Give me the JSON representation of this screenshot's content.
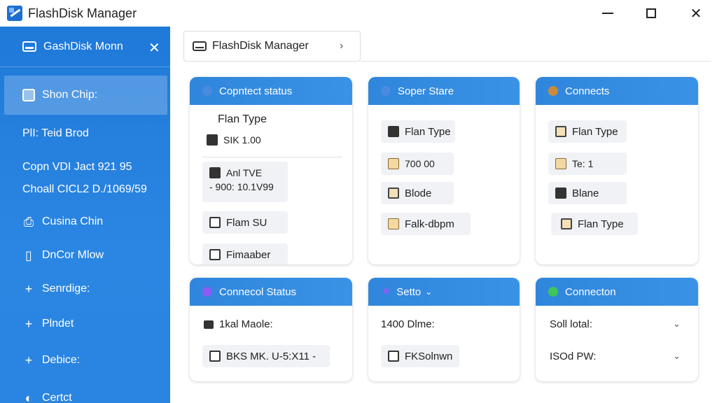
{
  "window": {
    "title": "FlashDisk Manager"
  },
  "sidebar": {
    "title": "GashDisk Monn",
    "items": [
      {
        "label": "Shon Chip:"
      },
      {
        "label": "PlI: Teid Brod"
      },
      {
        "label": "Copn VDI Jact 921 95"
      },
      {
        "label": "Choall CICL2 D./1069/59"
      },
      {
        "label": "Cusina Chin"
      },
      {
        "label": "DnCor Mlow"
      },
      {
        "label": "Senrdige:"
      },
      {
        "label": "Plndet"
      },
      {
        "label": "Debice:"
      },
      {
        "label": "Certct"
      }
    ]
  },
  "breadcrumb": {
    "label": "FlashDisk Manager"
  },
  "cards": {
    "c1": {
      "title": "Copntect status",
      "dot_color": "#4a8be0",
      "heading": "Flan Type",
      "line1": "SIK 1.00",
      "line2a": "Anl TVE",
      "line2b": "-  900: 10.1V99",
      "btn1": "Flam SU",
      "btn2": "Fimaaber"
    },
    "c2": {
      "title": "Soper Stare",
      "dot_color": "#4a8be0",
      "row1": "Flan Type",
      "row2": "700 00",
      "row3": "Blode",
      "row4": "Falk-dbpm"
    },
    "c3": {
      "title": "Connects",
      "dot_color": "#c98a3c",
      "row1": "Flan Type",
      "row2": "Te: 1",
      "row3": "Blane",
      "row4": "Flan Type"
    },
    "c4": {
      "title": "Connecol Status",
      "dot_color": "#8b5cf6",
      "row1": "1kal Maole:",
      "row2": "BKS MK. U-5:X11 -"
    },
    "c5": {
      "title": "Setto",
      "star_color": "#8b5cf6",
      "row1": "1400 Dlme:",
      "row2": "FKSolnwn"
    },
    "c6": {
      "title": "Connecton",
      "dot_color": "#3fc65a",
      "row1": "Soll lotal:",
      "row2": "ISOd PW:"
    }
  }
}
